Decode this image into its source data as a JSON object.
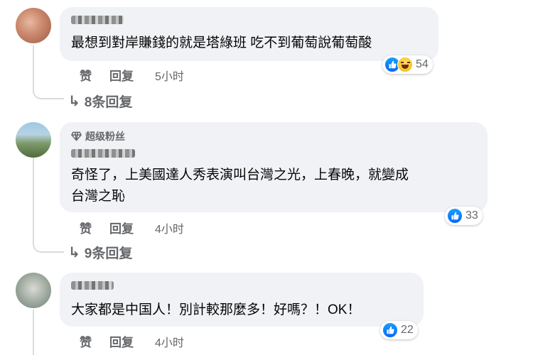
{
  "comments": [
    {
      "text_lines": [
        "最想到對岸賺錢的就是塔綠班 吃不到葡萄說葡萄酸"
      ],
      "reaction_count": "54",
      "reactions": [
        "like-icon",
        "haha-icon"
      ],
      "like_label": "赞",
      "reply_label": "回复",
      "time": "5小时",
      "replies_label": "8条回复"
    },
    {
      "badge": "超级粉丝",
      "text_lines": [
        "奇怪了，上美國達人秀表演叫台灣之光，上春晚，就變成",
        "台灣之恥"
      ],
      "reaction_count": "33",
      "reactions": [
        "like-icon"
      ],
      "like_label": "赞",
      "reply_label": "回复",
      "time": "4小时",
      "replies_label": "9条回复"
    },
    {
      "text_lines": [
        "大家都是中国人！別計較那麼多！好嗎？！OK！"
      ],
      "reaction_count": "22",
      "reactions": [
        "like-icon"
      ],
      "like_label": "赞",
      "reply_label": "回复",
      "time": "4小时"
    }
  ],
  "colors": {
    "bubble": "#f0f2f5",
    "secondary_text": "#65676b",
    "like_blue": "#0866ff"
  }
}
